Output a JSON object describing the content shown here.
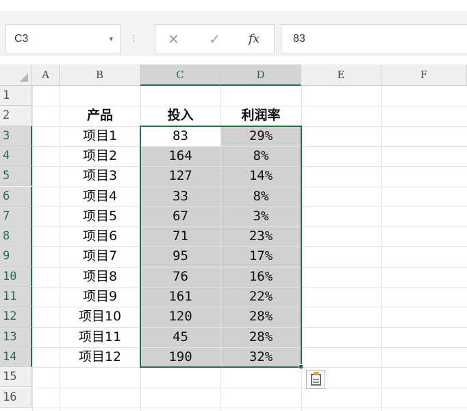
{
  "formula_bar": {
    "name_box": "C3",
    "name_box_dropdown": "▾",
    "separator": "⁝",
    "cancel_icon": "✕",
    "confirm_icon": "✓",
    "fx_label": "fx",
    "formula_value": "83"
  },
  "sheet": {
    "columns": [
      "A",
      "B",
      "C",
      "D",
      "E",
      "F"
    ],
    "rows": [
      "1",
      "2",
      "3",
      "4",
      "5",
      "6",
      "7",
      "8",
      "9",
      "10",
      "11",
      "12",
      "13",
      "14",
      "15",
      "16"
    ],
    "headers": {
      "product": "产品",
      "investment": "投入",
      "margin": "利润率"
    },
    "data": [
      {
        "product": "项目1",
        "investment": "83",
        "margin": "29%"
      },
      {
        "product": "项目2",
        "investment": "164",
        "margin": "8%"
      },
      {
        "product": "项目3",
        "investment": "127",
        "margin": "14%"
      },
      {
        "product": "项目4",
        "investment": "33",
        "margin": "8%"
      },
      {
        "product": "项目5",
        "investment": "67",
        "margin": "3%"
      },
      {
        "product": "项目6",
        "investment": "71",
        "margin": "23%"
      },
      {
        "product": "项目7",
        "investment": "95",
        "margin": "17%"
      },
      {
        "product": "项目8",
        "investment": "76",
        "margin": "16%"
      },
      {
        "product": "项目9",
        "investment": "161",
        "margin": "22%"
      },
      {
        "product": "项目10",
        "investment": "120",
        "margin": "28%"
      },
      {
        "product": "项目11",
        "investment": "45",
        "margin": "28%"
      },
      {
        "product": "项目12",
        "investment": "190",
        "margin": "32%"
      }
    ],
    "selection": {
      "active_cell": "C3",
      "range": "C3:D14"
    },
    "colors": {
      "accent": "#217346",
      "selection_fill": "#d1d1d1",
      "header_fill": "#f0f0f0"
    },
    "icons": {
      "paste_options": "paste-options-icon",
      "select_all": "select-all-corner-icon"
    }
  }
}
